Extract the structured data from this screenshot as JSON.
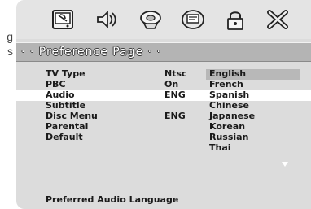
{
  "edge_fragments": [
    "g",
    "s"
  ],
  "toolbar": {
    "icons": [
      {
        "name": "general-setup-icon"
      },
      {
        "name": "audio-setup-icon"
      },
      {
        "name": "video-setup-icon"
      },
      {
        "name": "preference-icon"
      },
      {
        "name": "password-lock-icon"
      },
      {
        "name": "exit-icon"
      }
    ]
  },
  "header": {
    "title": "· · Preference Page · ·"
  },
  "menu": {
    "items": [
      {
        "label": "TV Type",
        "value": "Ntsc"
      },
      {
        "label": "PBC",
        "value": "On"
      },
      {
        "label": "Audio",
        "value": "ENG",
        "active": true
      },
      {
        "label": "Subtitle",
        "value": ""
      },
      {
        "label": "Disc Menu",
        "value": "ENG"
      },
      {
        "label": "Parental",
        "value": ""
      },
      {
        "label": "Default",
        "value": ""
      }
    ]
  },
  "dropdown": {
    "options": [
      "English",
      "French",
      "Spanish",
      "Chinese",
      "Japanese",
      "Korean",
      "Russian",
      "Thai"
    ],
    "selected_index": 0
  },
  "status": {
    "text": "Preferred Audio Language"
  },
  "colors": {
    "screen_bg": "#dcdcdc",
    "header_bg": "#b4b4b4",
    "active_row": "#ffffff",
    "selected_option": "#b8b8b8",
    "text": "#1a1a1a"
  }
}
